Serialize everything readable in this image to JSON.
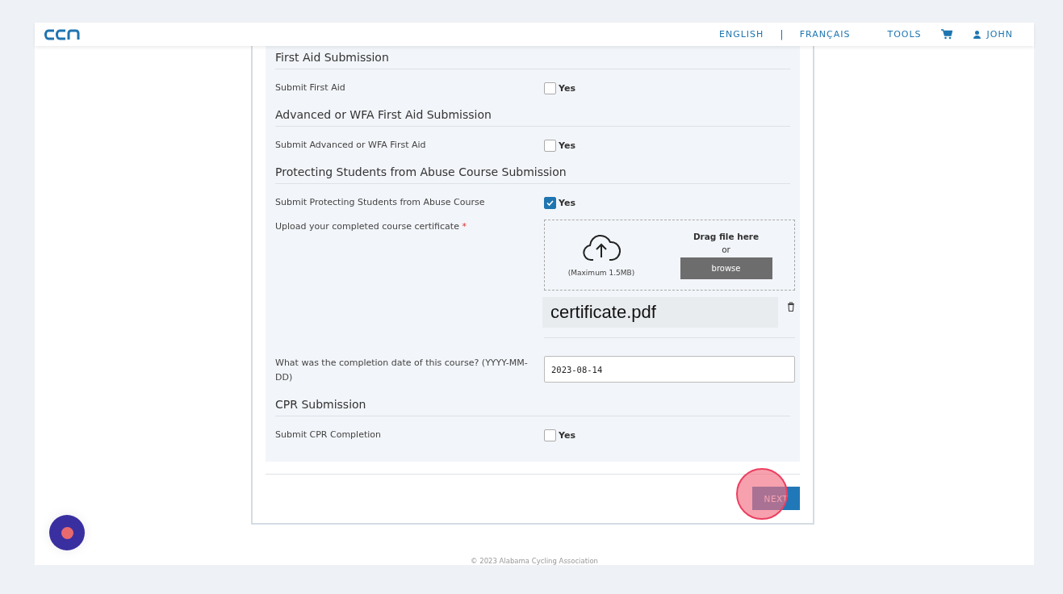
{
  "header": {
    "nav": [
      "ENGLISH",
      "FRANÇAIS"
    ],
    "separator": "|",
    "tools": "TOOLS",
    "user": "JOHN"
  },
  "sections": [
    {
      "title": "First Aid Submission",
      "rows": [
        {
          "kind": "checkbox",
          "label": "Submit First Aid",
          "option": "Yes",
          "checked": false
        }
      ]
    },
    {
      "title": "Advanced or WFA First Aid Submission",
      "rows": [
        {
          "kind": "checkbox",
          "label": "Submit Advanced or WFA First Aid",
          "option": "Yes",
          "checked": false
        }
      ]
    },
    {
      "title": "Protecting Students from Abuse Course Submission",
      "rows": [
        {
          "kind": "checkbox",
          "label": "Submit Protecting Students from Abuse Course",
          "option": "Yes",
          "checked": true
        },
        {
          "kind": "upload",
          "label": "Upload your completed course certificate",
          "required": "*",
          "max": "(Maximum 1.5MB)",
          "drag": "Drag file here",
          "or": "or",
          "browse": "browse",
          "file": "certificate.pdf"
        },
        {
          "kind": "date",
          "label": "What was the completion date of this course? (YYYY-MM-DD)",
          "value": "2023-08-14"
        }
      ]
    },
    {
      "title": "CPR Submission",
      "rows": [
        {
          "kind": "checkbox",
          "label": "Submit CPR Completion",
          "option": "Yes",
          "checked": false
        }
      ]
    }
  ],
  "next": "NEXT",
  "footer": "© 2023 Alabama Cycling Association"
}
